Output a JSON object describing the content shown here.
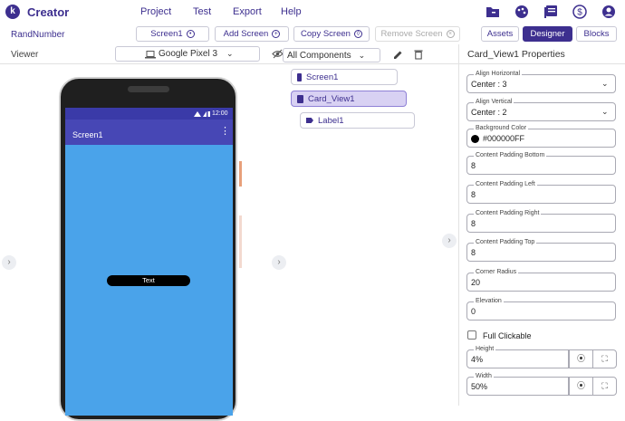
{
  "app": {
    "logo_letter": "k",
    "title": "Creator"
  },
  "menu": [
    "Project",
    "Test",
    "Export",
    "Help"
  ],
  "project_name": "RandNumber",
  "toolbar": {
    "screen_select": "Screen1",
    "add_screen": "Add Screen",
    "copy_screen": "Copy Screen",
    "remove_screen": "Remove Screen",
    "assets": "Assets",
    "designer": "Designer",
    "blocks": "Blocks"
  },
  "viewer": {
    "label": "Viewer",
    "device": "Google Pixel 3",
    "status_time": "12:00",
    "screen_title": "Screen1",
    "card_text": "Text"
  },
  "components": {
    "filter": "All Components",
    "tree": [
      {
        "label": "Screen1",
        "selected": false
      },
      {
        "label": "Card_View1",
        "selected": true
      },
      {
        "label": "Label1",
        "selected": false
      }
    ]
  },
  "properties": {
    "title": "Card_View1 Properties",
    "align_horizontal": {
      "label": "Align Horizontal",
      "value": "Center : 3"
    },
    "align_vertical": {
      "label": "Align Vertical",
      "value": "Center : 2"
    },
    "background_color": {
      "label": "Background Color",
      "value": "#000000FF"
    },
    "content_padding_bottom": {
      "label": "Content Padding Bottom",
      "value": "8"
    },
    "content_padding_left": {
      "label": "Content Padding Left",
      "value": "8"
    },
    "content_padding_right": {
      "label": "Content Padding Right",
      "value": "8"
    },
    "content_padding_top": {
      "label": "Content Padding Top",
      "value": "8"
    },
    "corner_radius": {
      "label": "Corner Radius",
      "value": "20"
    },
    "elevation": {
      "label": "Elevation",
      "value": "0"
    },
    "full_clickable": {
      "label": "Full Clickable"
    },
    "height": {
      "label": "Height",
      "value": "4%"
    },
    "width": {
      "label": "Width",
      "value": "50%"
    }
  },
  "colors": {
    "accent": "#3d2f8f",
    "screen_bg": "#4aa3ea",
    "appbar": "#4747b5",
    "card_bg": "#000000"
  }
}
